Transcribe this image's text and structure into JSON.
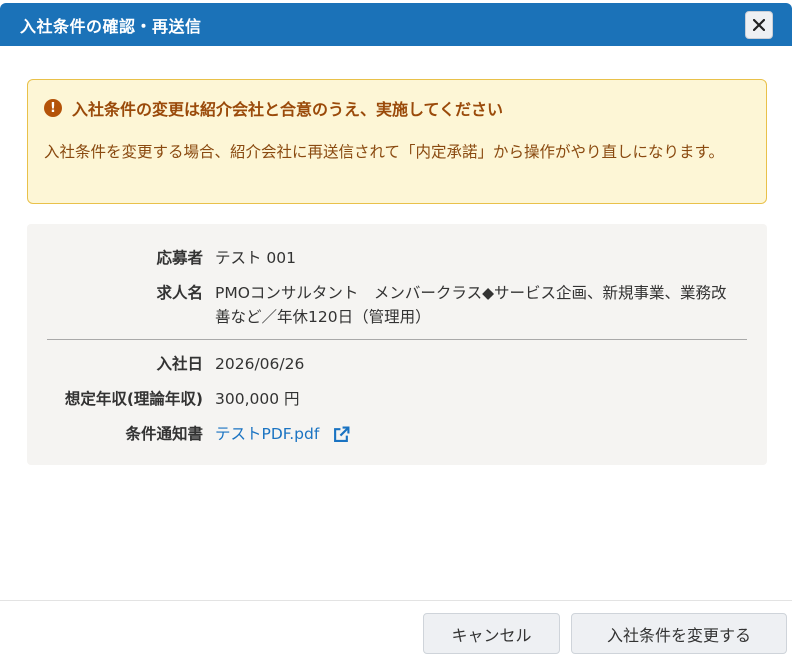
{
  "dialog": {
    "title": "入社条件の確認・再送信"
  },
  "alert": {
    "icon": "exclamation-circle-icon",
    "title": "入社条件の変更は紹介会社と合意のうえ、実施してください",
    "body": "入社条件を変更する場合、紹介会社に再送信されて「内定承諾」から操作がやり直しになります。"
  },
  "info": {
    "applicant_label": "応募者",
    "applicant_value": "テスト 001",
    "job_label": "求人名",
    "job_value": "PMOコンサルタント　メンバークラス◆サービス企画、新規事業、業務改善など／年休120日（管理用）",
    "start_date_label": "入社日",
    "start_date_value": "2026/06/26",
    "salary_label": "想定年収(理論年収)",
    "salary_value": "300,000 円",
    "notice_label": "条件通知書",
    "notice_file": "テストPDF.pdf",
    "notice_icon": "external-link-icon"
  },
  "footer": {
    "cancel_label": "キャンセル",
    "change_label": "入社条件を変更する"
  },
  "colors": {
    "titlebar": "#1b72b8",
    "alert_bg": "#fdf6d6",
    "alert_border": "#e9c14a",
    "alert_text": "#9a4a0a",
    "link": "#1a73c2"
  }
}
